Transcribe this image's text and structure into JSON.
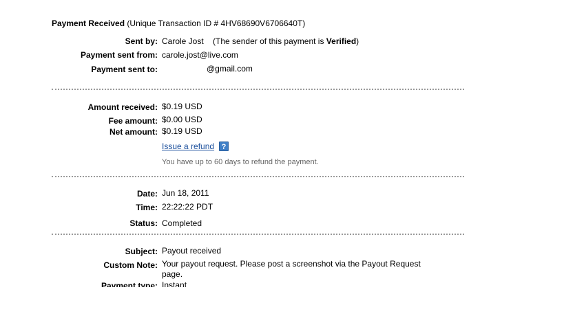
{
  "header": {
    "title": "Payment Received",
    "transaction_text": "(Unique Transaction ID # 4HV68690V6706640T)"
  },
  "sender": {
    "sent_by_label": "Sent by:",
    "sent_by_name": "Carole Jost",
    "verified_prefix": "(The sender of this payment is ",
    "verified_word": "Verified",
    "verified_suffix": ")",
    "sent_from_label": "Payment sent from:",
    "sent_from_value": "carole.jost@live.com",
    "sent_to_label": "Payment sent to:",
    "sent_to_value": "@gmail.com"
  },
  "amounts": {
    "received_label": "Amount received:",
    "received_value": "$0.19 USD",
    "fee_label": "Fee amount:",
    "fee_value": "$0.00 USD",
    "net_label": "Net amount:",
    "net_value": "$0.19 USD",
    "refund_link": "Issue a refund",
    "help_icon_glyph": "?",
    "refund_note": "You have up to 60 days to refund the payment."
  },
  "timing": {
    "date_label": "Date:",
    "date_value": "Jun 18, 2011",
    "time_label": "Time:",
    "time_value": "22:22:22 PDT",
    "status_label": "Status:",
    "status_value": "Completed"
  },
  "details": {
    "subject_label": "Subject:",
    "subject_value": "Payout received",
    "custom_note_label": "Custom Note:",
    "custom_note_value": "Your payout request. Please post a screenshot via the Payout Request page.",
    "payment_type_label": "Payment type:",
    "payment_type_value": "Instant"
  },
  "colors": {
    "link": "#1b4f9c",
    "help_icon_bg": "#3f7fc7",
    "divider": "#9a9a9a",
    "note_text": "#666666"
  }
}
